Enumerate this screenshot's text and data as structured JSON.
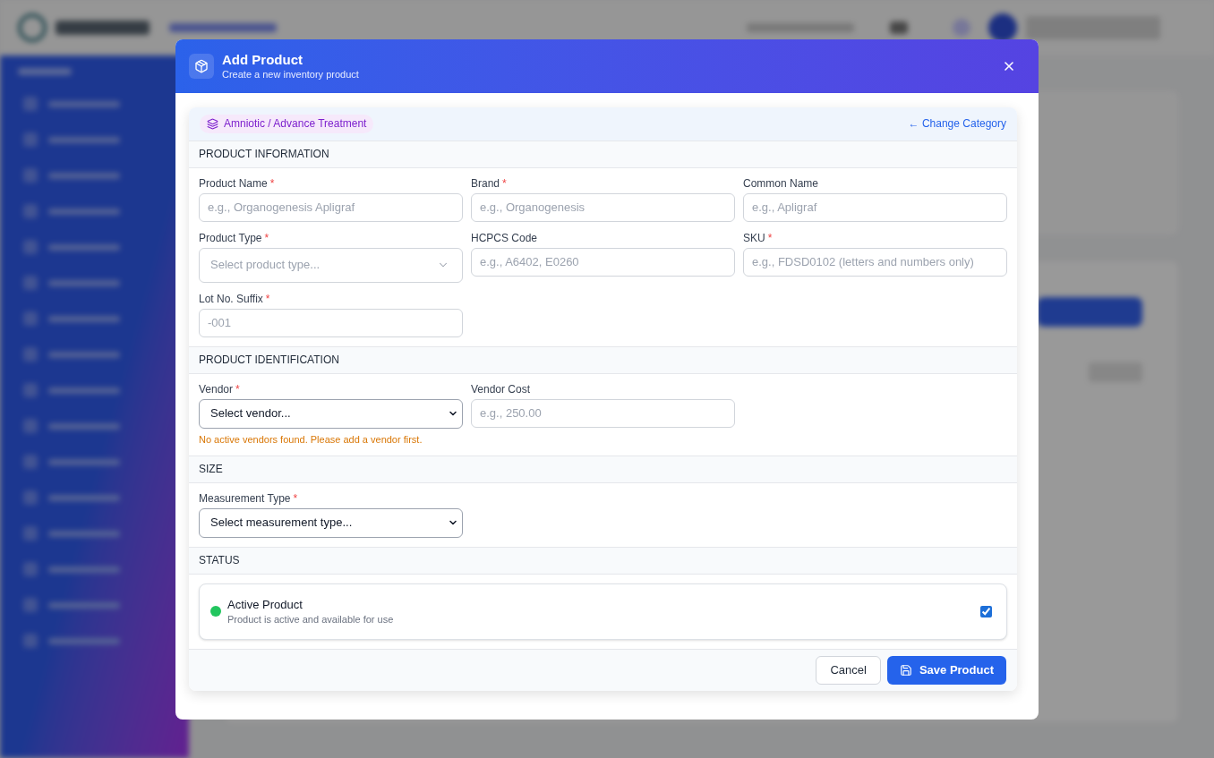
{
  "dialog": {
    "title": "Add Product",
    "subtitle": "Create a new inventory product"
  },
  "category": {
    "label": "Amniotic / Advance Treatment",
    "change_link": "← Change Category"
  },
  "sections": [
    {
      "title": "PRODUCT INFORMATION",
      "kind": "fields",
      "fields": [
        {
          "kind": "input",
          "label": "Product Name",
          "required_mark": "*",
          "placeholder": "e.g., Organogenesis Apligraf"
        },
        {
          "kind": "input",
          "label": "Brand",
          "required_mark": "*",
          "placeholder": "e.g., Organogenesis"
        },
        {
          "kind": "input",
          "label": "Common Name",
          "placeholder": "e.g., Apligraf"
        },
        {
          "kind": "select",
          "label": "Product Type",
          "required_mark": "*",
          "placeholder": "Select product type..."
        },
        {
          "kind": "input",
          "label": "HCPCS Code",
          "placeholder": "e.g., A6402, E0260"
        },
        {
          "kind": "input",
          "label": "SKU",
          "required_mark": "*",
          "placeholder": "e.g., FDSD0102 (letters and numbers only)"
        },
        {
          "kind": "input",
          "label": "Lot No. Suffix",
          "required_mark": "*",
          "placeholder": "-001"
        }
      ]
    },
    {
      "title": "PRODUCT IDENTIFICATION",
      "kind": "fields",
      "fields": [
        {
          "kind": "dropdown",
          "label": "Vendor",
          "required_mark": "*",
          "value": "Select vendor...",
          "note": "No active vendors found. Please add a vendor first."
        },
        {
          "kind": "input",
          "label": "Vendor Cost",
          "placeholder": "e.g., 250.00"
        }
      ]
    },
    {
      "title": "SIZE",
      "kind": "fields",
      "fields": [
        {
          "kind": "dropdown",
          "label": "Measurement Type",
          "required_mark": "*",
          "value": "Select measurement type..."
        }
      ]
    },
    {
      "title": "STATUS",
      "kind": "toggle",
      "toggle": {
        "title": "Active Product",
        "description": "Product is active and available for use",
        "checked": true
      }
    }
  ],
  "footer": {
    "buttons": [
      {
        "kind": "secondary",
        "label": "Cancel"
      },
      {
        "kind": "primary",
        "label": "Save Product"
      }
    ]
  }
}
